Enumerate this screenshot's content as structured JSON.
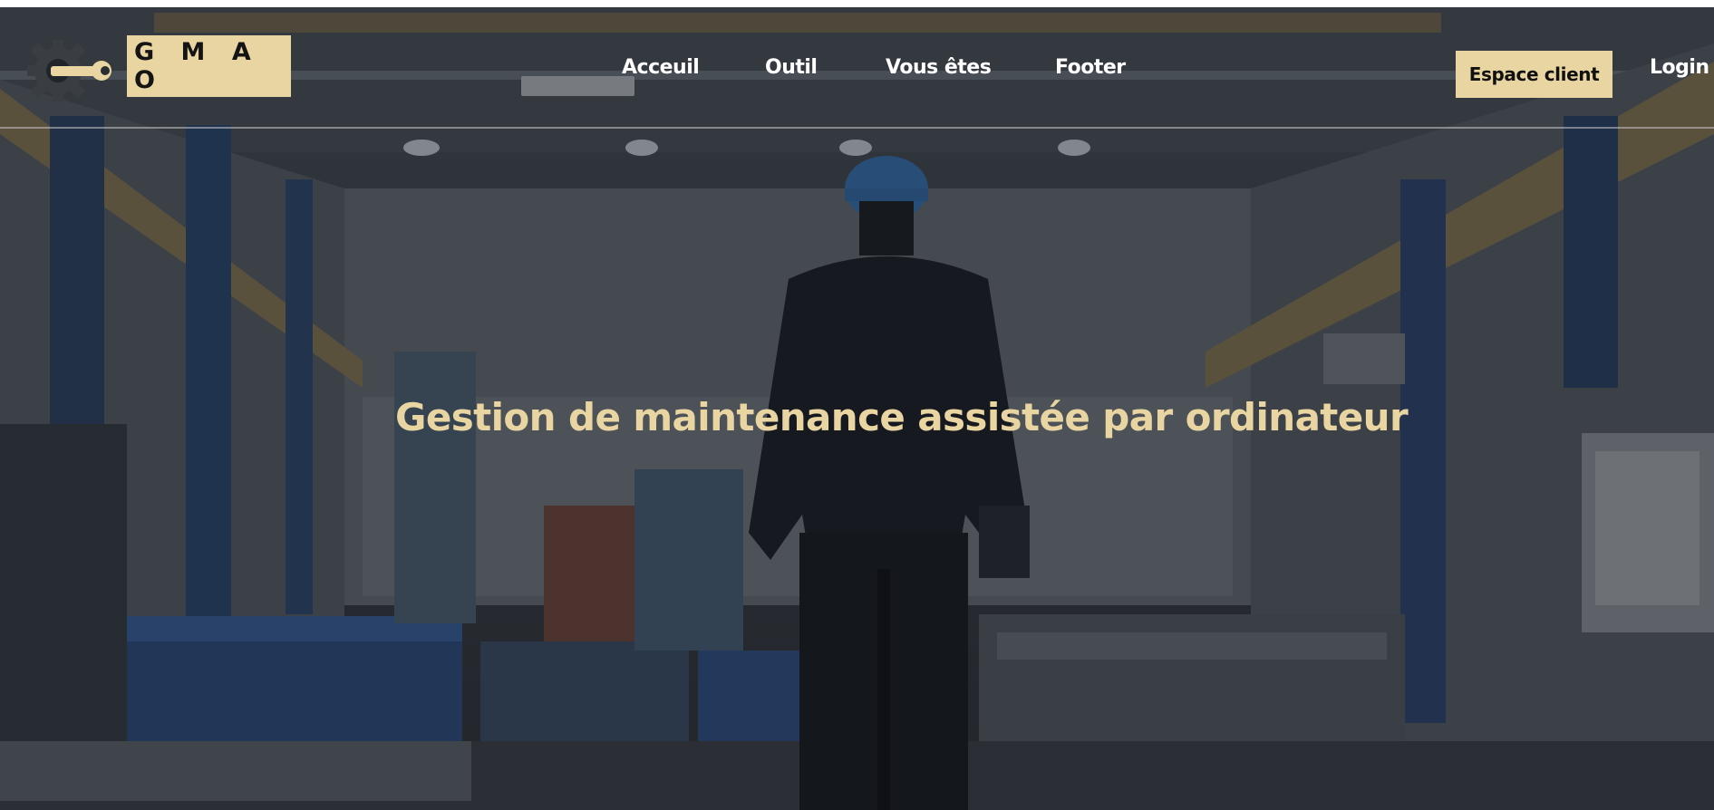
{
  "colors": {
    "accent": "#e9d5a1",
    "nav_text": "#ffffff",
    "hero_overlay": "#2f353c"
  },
  "header": {
    "logo_icon": "gear-wrench-icon",
    "brand": "G M A O",
    "nav": [
      {
        "label": "Acceuil"
      },
      {
        "label": "Outil"
      },
      {
        "label": "Vous êtes"
      },
      {
        "label": "Footer"
      }
    ],
    "cta_label": "Espace client",
    "login_label": "Login"
  },
  "hero": {
    "background": "factory-worker-photo",
    "title": "Gestion de maintenance assistée par ordinateur"
  }
}
